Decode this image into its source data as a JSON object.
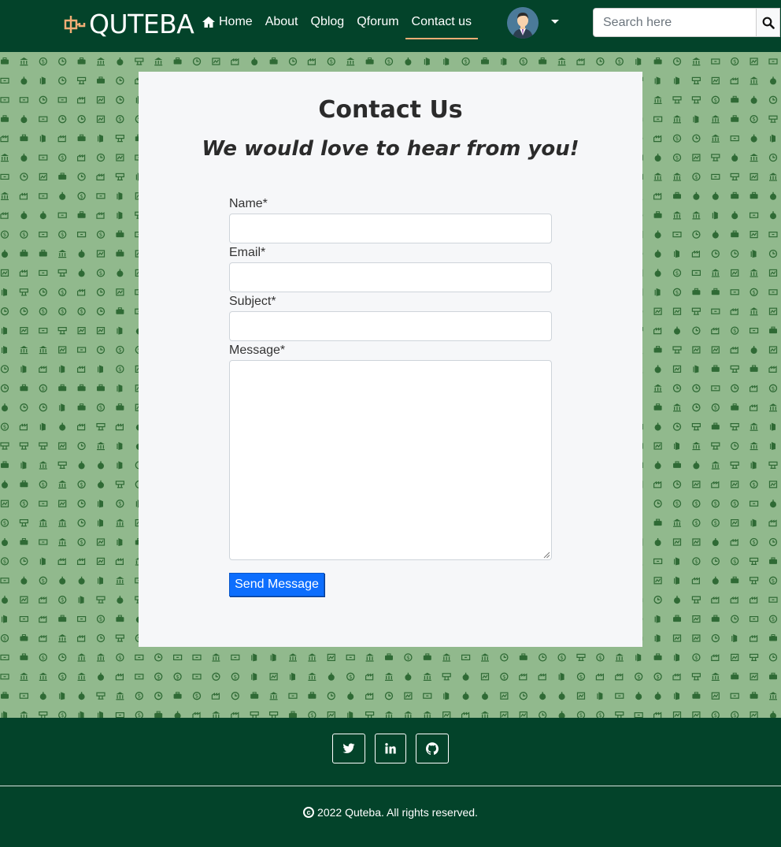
{
  "brand": {
    "name": "QUTEBA",
    "accent_color": "#f0ad75"
  },
  "nav": {
    "items": [
      {
        "label": "Home",
        "icon": "home-icon"
      },
      {
        "label": "About"
      },
      {
        "label": "Qblog"
      },
      {
        "label": "Qforum"
      },
      {
        "label": "Contact us",
        "active": true
      }
    ]
  },
  "user": {
    "avatar": "user-avatar",
    "menu_icon": "chevron-down-icon"
  },
  "search": {
    "placeholder": "Search here",
    "button_icon": "search-icon"
  },
  "contact": {
    "title": "Contact Us",
    "subtitle": "We would love to hear from you!",
    "fields": {
      "name_label": "Name*",
      "email_label": "Email*",
      "subject_label": "Subject*",
      "message_label": "Message*"
    },
    "submit_label": "Send Message"
  },
  "footer": {
    "social": [
      "twitter-icon",
      "linkedin-icon",
      "github-icon"
    ],
    "copyright": "2022 Quteba. All rights reserved."
  },
  "colors": {
    "nav_bg": "#03432a",
    "pattern_bg": "#91b98d",
    "pattern_icon": "#2f6a35",
    "primary_button": "#0d6efd"
  }
}
